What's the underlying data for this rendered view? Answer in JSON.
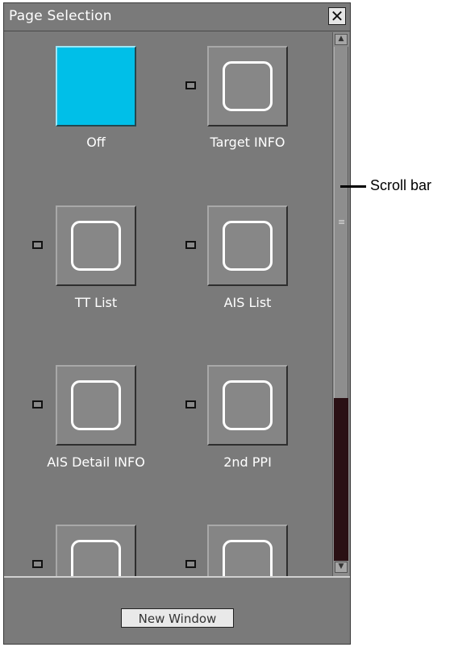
{
  "window": {
    "title": "Page Selection",
    "close_glyph": "✕"
  },
  "tiles": [
    {
      "label": "Off",
      "active": true,
      "checkbox": false
    },
    {
      "label": "Target INFO",
      "active": false,
      "checkbox": true
    },
    {
      "label": "TT List",
      "active": false,
      "checkbox": true
    },
    {
      "label": "AIS List",
      "active": false,
      "checkbox": true
    },
    {
      "label": "AIS Detail INFO",
      "active": false,
      "checkbox": true
    },
    {
      "label": "2nd PPI",
      "active": false,
      "checkbox": true
    },
    {
      "label": "",
      "active": false,
      "checkbox": true
    },
    {
      "label": "",
      "active": false,
      "checkbox": true
    }
  ],
  "scrollbar": {
    "up_glyph": "▲",
    "down_glyph": "▼",
    "grip_glyph": "≡"
  },
  "footer": {
    "new_window_label": "New Window"
  },
  "annotation": {
    "scroll_bar_label": "Scroll bar"
  },
  "colors": {
    "panel": "#7a7a7a",
    "active_tile": "#00bfe8",
    "track": "#2a1014"
  }
}
